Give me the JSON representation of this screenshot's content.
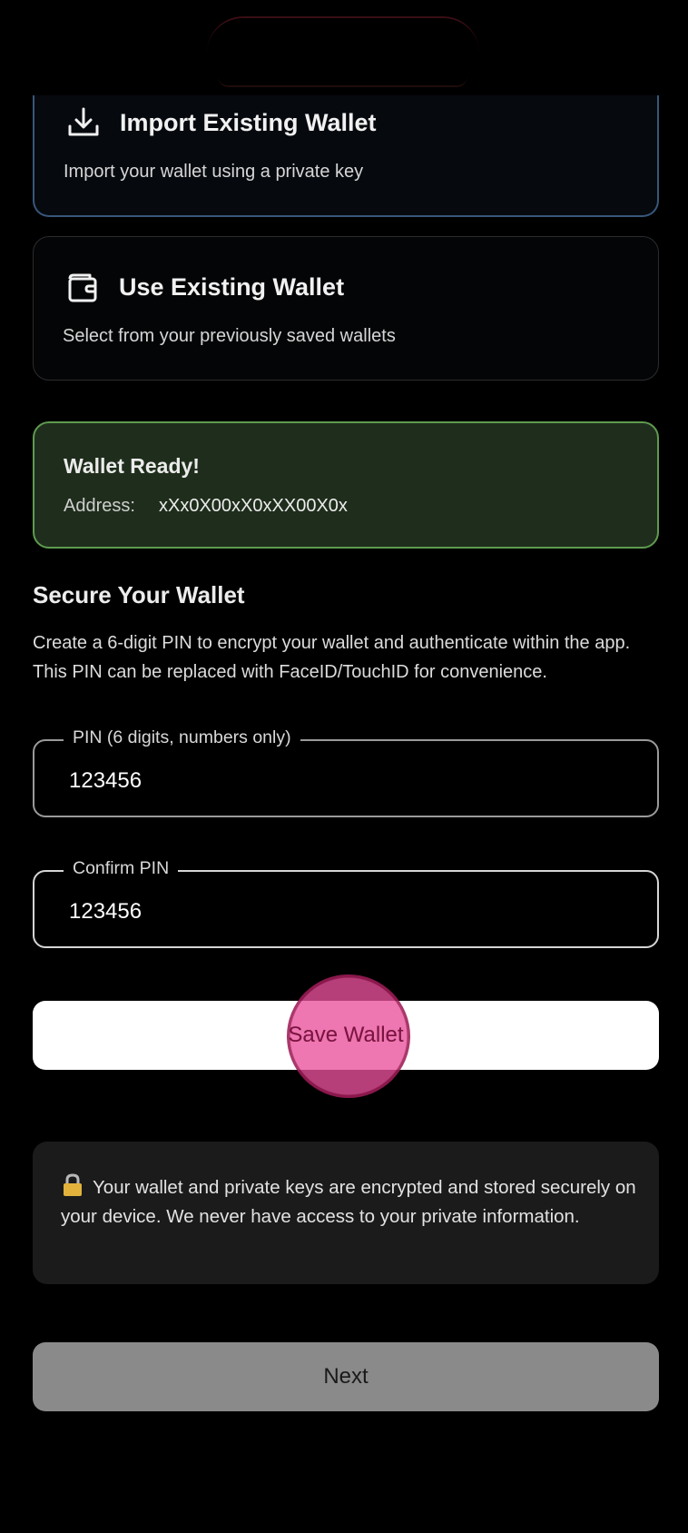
{
  "options": {
    "import": {
      "title": "Import Existing Wallet",
      "description": "Import your wallet using a private key",
      "icon": "download-icon"
    },
    "use_existing": {
      "title": "Use Existing Wallet",
      "description": "Select from your previously saved wallets",
      "icon": "wallet-icon"
    }
  },
  "wallet_status": {
    "title": "Wallet Ready!",
    "address_label": "Address:",
    "address_value": "xXx0X00xX0xXX00X0x"
  },
  "secure": {
    "title": "Secure Your Wallet",
    "description": "Create a 6-digit PIN to encrypt your wallet and authenticate within the app. This PIN can be replaced with FaceID/TouchID for convenience."
  },
  "pin_field": {
    "label": "PIN (6 digits, numbers only)",
    "value": "123456"
  },
  "confirm_field": {
    "label": "Confirm PIN",
    "value": "123456"
  },
  "save_button": {
    "label": "Save Wallet"
  },
  "info": {
    "icon": "lock-icon",
    "text": "Your wallet and private keys are encrypted and stored securely on your device. We never have access to your private information."
  },
  "next_button": {
    "label": "Next"
  },
  "colors": {
    "success_border": "#5e9b4f",
    "success_bg": "#1f2e1c",
    "selected_border": "#37577a",
    "tap_highlight": "#e9509b"
  }
}
